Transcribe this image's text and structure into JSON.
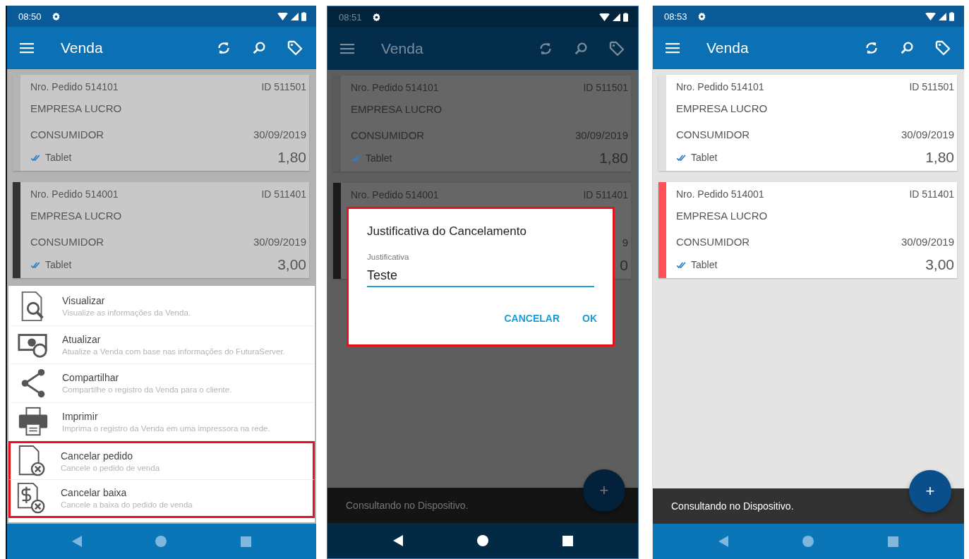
{
  "phones": [
    {
      "status_time": "08:50",
      "title": "Venda",
      "dimmed": true,
      "orders": [
        {
          "number": "Nro. Pedido 514101",
          "id": "ID 511501",
          "company": "EMPRESA LUCRO",
          "customer": "CONSUMIDOR",
          "date": "30/09/2019",
          "device": "Tablet",
          "total": "1,80",
          "color": "#b4b4b4"
        },
        {
          "number": "Nro. Pedido 514001",
          "id": "ID 511401",
          "company": "EMPRESA LUCRO",
          "customer": "CONSUMIDOR",
          "date": "30/09/2019",
          "device": "Tablet",
          "total": "3,00",
          "color": "#333333"
        }
      ],
      "sheet": {
        "items": [
          {
            "title": "Visualizar",
            "subtitle": "Visualize as informações da Venda.",
            "highlighted": false
          },
          {
            "title": "Atualizar",
            "subtitle": "Atualize a Venda com base nas informações do FuturaServer.",
            "highlighted": false
          },
          {
            "title": "Compartilhar",
            "subtitle": "Compartilhe o registro da Venda para o cliente.",
            "highlighted": false
          },
          {
            "title": "Imprimir",
            "subtitle": "Imprima o registro da Venda em uma impressora na rede.",
            "highlighted": false
          },
          {
            "title": "Cancelar pedido",
            "subtitle": "Cancele o pedido de venda",
            "highlighted": true
          },
          {
            "title": "Cancelar baixa",
            "subtitle": "Cancele a baixa do pedido de venda",
            "highlighted": true
          }
        ]
      }
    },
    {
      "status_time": "08:51",
      "title": "Venda",
      "dimmed": true,
      "orders": [
        {
          "number": "Nro. Pedido 514101",
          "id": "ID 511501",
          "company": "EMPRESA LUCRO",
          "customer": "CONSUMIDOR",
          "date": "30/09/2019",
          "device": "Tablet",
          "total": "1,80",
          "color": "#5a5a5a"
        },
        {
          "number": "Nro. Pedido 514001",
          "id": "ID 511401",
          "date": "9",
          "total": "0",
          "color": "#1a1a1a"
        }
      ],
      "dialog": {
        "title": "Justificativa do Cancelamento",
        "label": "Justificativa",
        "value": "Teste",
        "buttons": [
          "CANCELAR",
          "OK"
        ],
        "highlighted": true
      },
      "snackbar": "Consultando no Dispositivo.",
      "fab": "+"
    },
    {
      "status_time": "08:53",
      "title": "Venda",
      "dimmed": false,
      "orders": [
        {
          "number": "Nro. Pedido 514101",
          "id": "ID 511501",
          "company": "EMPRESA LUCRO",
          "customer": "CONSUMIDOR",
          "date": "30/09/2019",
          "device": "Tablet",
          "total": "1,80",
          "color": "#e0e0e0"
        },
        {
          "number": "Nro. Pedido 514001",
          "id": "ID 511401",
          "company": "EMPRESA LUCRO",
          "customer": "CONSUMIDOR",
          "date": "30/09/2019",
          "device": "Tablet",
          "total": "3,00",
          "color": "#ff5257"
        }
      ],
      "snackbar": "Consultando no Dispositivo.",
      "fab": "+"
    }
  ]
}
